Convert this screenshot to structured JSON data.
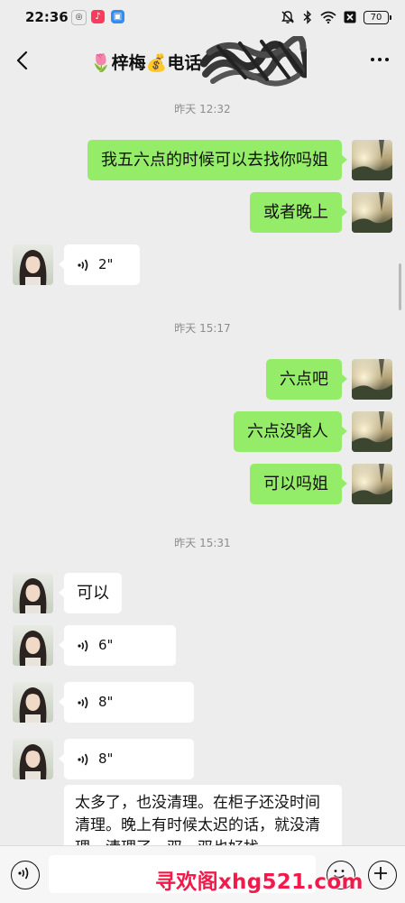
{
  "status_bar": {
    "time": "22:36",
    "battery": "70",
    "app_icons": [
      "glasses-app-icon",
      "music-app-icon",
      "blue-app-icon"
    ],
    "icons": [
      "mute-bell-icon",
      "bluetooth-icon",
      "wifi-icon",
      "sim-off-icon",
      "battery-icon"
    ]
  },
  "header": {
    "title": "🌷梓梅💰电话",
    "back_icon": "chevron-left-icon",
    "more_icon": "more-dots-icon"
  },
  "messages": [
    {
      "type": "timestamp",
      "text": "昨天 12:32"
    },
    {
      "type": "text",
      "direction": "sent",
      "text": "我五六点的时候可以去找你吗姐"
    },
    {
      "type": "text",
      "direction": "sent",
      "text": "或者晚上"
    },
    {
      "type": "voice",
      "direction": "received",
      "duration": "2\""
    },
    {
      "type": "timestamp",
      "text": "昨天 15:17"
    },
    {
      "type": "text",
      "direction": "sent",
      "text": "六点吧"
    },
    {
      "type": "text",
      "direction": "sent",
      "text": "六点没啥人"
    },
    {
      "type": "text",
      "direction": "sent",
      "text": "可以吗姐"
    },
    {
      "type": "timestamp",
      "text": "昨天 15:31"
    },
    {
      "type": "text",
      "direction": "received",
      "text": "可以"
    },
    {
      "type": "voice",
      "direction": "received",
      "duration": "6\""
    },
    {
      "type": "voice",
      "direction": "received",
      "duration": "8\""
    },
    {
      "type": "voice",
      "direction": "received",
      "duration": "8\""
    },
    {
      "type": "text",
      "direction": "received",
      "text": "太多了，也没清理。在柜子还没时间清理。晚上有时候太迟的话，就没清理。清理了一双，双也好找"
    }
  ],
  "input_bar": {
    "voice_icon": "voice-input-icon",
    "emoji_icon": "emoji-icon",
    "plus_icon": "plus-icon"
  },
  "watermark": "寻欢阁xhg521.com",
  "colors": {
    "background": "#ededed",
    "sent_bubble": "#95ec69",
    "received_bubble": "#ffffff",
    "timestamp": "#8c8c8c",
    "watermark": "#f01b4a"
  }
}
